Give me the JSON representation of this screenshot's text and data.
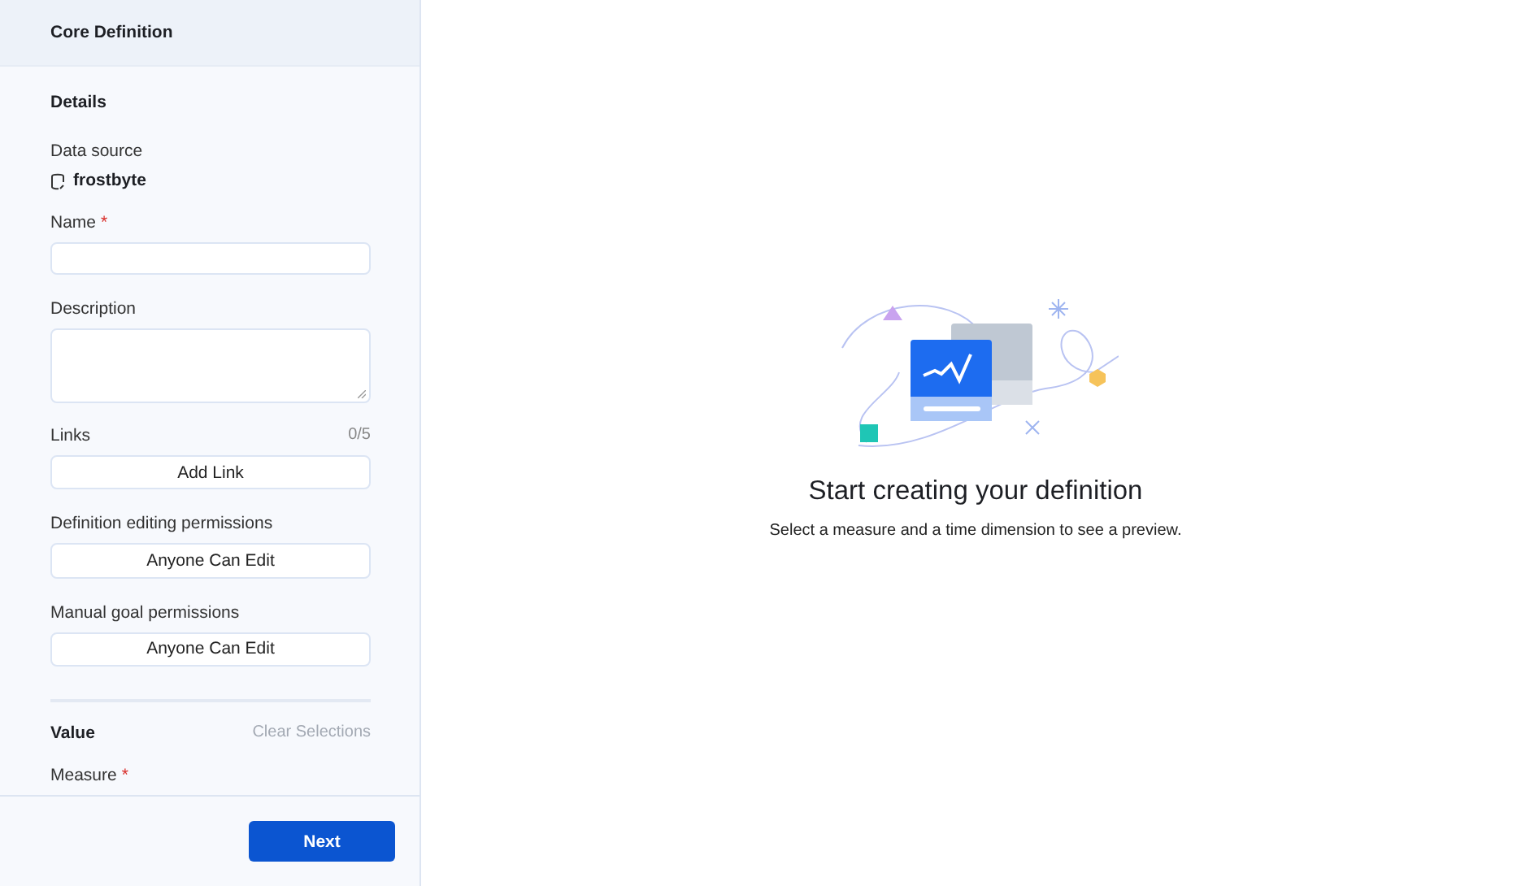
{
  "sidebar": {
    "header": "Core Definition",
    "section": "Details",
    "data_source": {
      "label": "Data source",
      "value": "frostbyte"
    },
    "name_field": {
      "label": "Name",
      "required_mark": "*"
    },
    "description_field": {
      "label": "Description"
    },
    "links": {
      "label": "Links",
      "count": "0/5",
      "button": "Add Link"
    },
    "editing_permissions": {
      "label": "Definition editing permissions",
      "value": "Anyone Can Edit"
    },
    "goal_permissions": {
      "label": "Manual goal permissions",
      "value": "Anyone Can Edit"
    },
    "value_section": {
      "title": "Value",
      "clear": "Clear Selections",
      "clear_disabled": true
    },
    "measure_field": {
      "label": "Measure",
      "required_mark": "*"
    },
    "footer": {
      "button": "Next"
    }
  },
  "empty_state": {
    "title": "Start creating your definition",
    "subtitle": "Select a measure and a time dimension to see a preview."
  }
}
